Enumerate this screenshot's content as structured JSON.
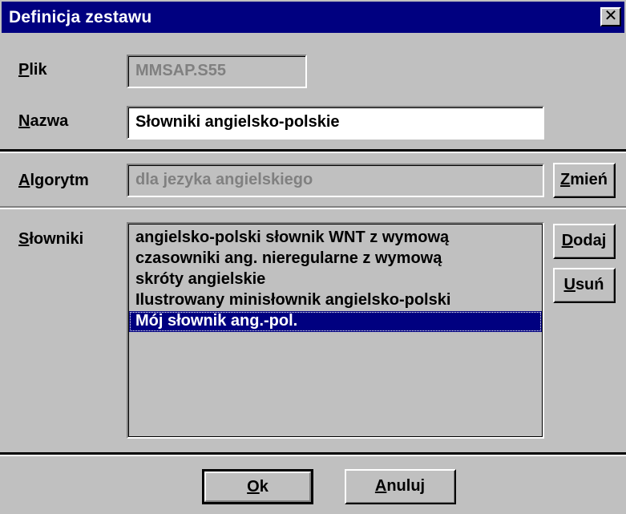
{
  "dialog": {
    "title": "Definicja zestawu",
    "close_glyph": "✕"
  },
  "plik": {
    "label_mnemonic": "P",
    "label_rest": "lik",
    "value": "MMSAP.S55"
  },
  "nazwa": {
    "label_mnemonic": "N",
    "label_rest": "azwa",
    "value": "Słowniki angielsko-polskie"
  },
  "algorytm": {
    "label_mnemonic": "A",
    "label_rest": "lgorytm",
    "value": "dla jezyka angielskiego",
    "change_mnemonic": "Z",
    "change_rest": "mień"
  },
  "slowniki": {
    "label_mnemonic": "S",
    "label_rest": "łowniki",
    "items": [
      {
        "label": "angielsko-polski słownik WNT z wymową",
        "selected": false
      },
      {
        "label": "czasowniki ang. nieregularne z wymową",
        "selected": false
      },
      {
        "label": "skróty angielskie",
        "selected": false
      },
      {
        "label": "Ilustrowany minisłownik angielsko-polski",
        "selected": false
      },
      {
        "label": "Mój słownik ang.-pol.",
        "selected": true
      }
    ],
    "add_mnemonic": "D",
    "add_rest": "odaj",
    "remove_mnemonic": "U",
    "remove_rest": "suń"
  },
  "footer": {
    "ok_mnemonic": "O",
    "ok_rest": "k",
    "cancel_mnemonic": "A",
    "cancel_rest": "nuluj"
  },
  "colors": {
    "face": "#c0c0c0",
    "titlebar": "#000080",
    "selection": "#000080",
    "disabled_text": "#808080"
  }
}
